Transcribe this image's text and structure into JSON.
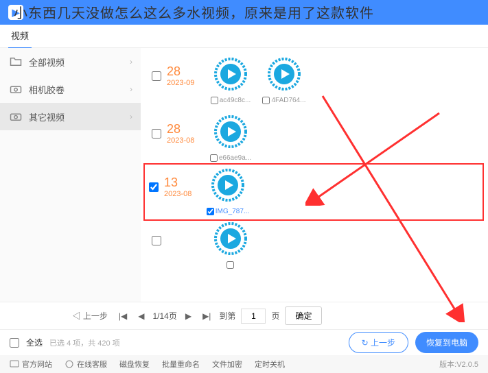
{
  "overlay": "小东西几天没做怎么这么多水视频，原来是用了这款软件",
  "tab": "视频",
  "sidebar": [
    {
      "label": "全部视频",
      "active": false
    },
    {
      "label": "相机胶卷",
      "active": false
    },
    {
      "label": "其它视频",
      "active": true
    }
  ],
  "groups": [
    {
      "day": "28",
      "ym": "2023-09",
      "sel": false,
      "files": [
        {
          "name": "ac49c8c...",
          "sel": false
        },
        {
          "name": "4FAD764...",
          "sel": false
        }
      ]
    },
    {
      "day": "28",
      "ym": "2023-08",
      "sel": false,
      "files": [
        {
          "name": "e66ae9a...",
          "sel": false
        }
      ]
    },
    {
      "day": "13",
      "ym": "2023-08",
      "sel": true,
      "files": [
        {
          "name": "IMG_787...",
          "sel": true
        }
      ],
      "hl": true
    },
    {
      "day": "",
      "ym": "",
      "sel": false,
      "files": [
        {
          "name": "",
          "sel": false
        }
      ]
    }
  ],
  "pager": {
    "prev": "上一步",
    "info": "1/14页",
    "goto": "到第",
    "val": "1",
    "unit": "页",
    "ok": "确定"
  },
  "bottom": {
    "all": "全选",
    "info": "已选 4 项，共 420 项",
    "prev": "↻ 上一步",
    "recover": "恢复到电脑"
  },
  "footer": {
    "site": "官方网站",
    "cs": "在线客服",
    "l1": "磁盘恢复",
    "l2": "批量重命名",
    "l3": "文件加密",
    "l4": "定时关机",
    "ver": "版本:V2.0.5"
  }
}
